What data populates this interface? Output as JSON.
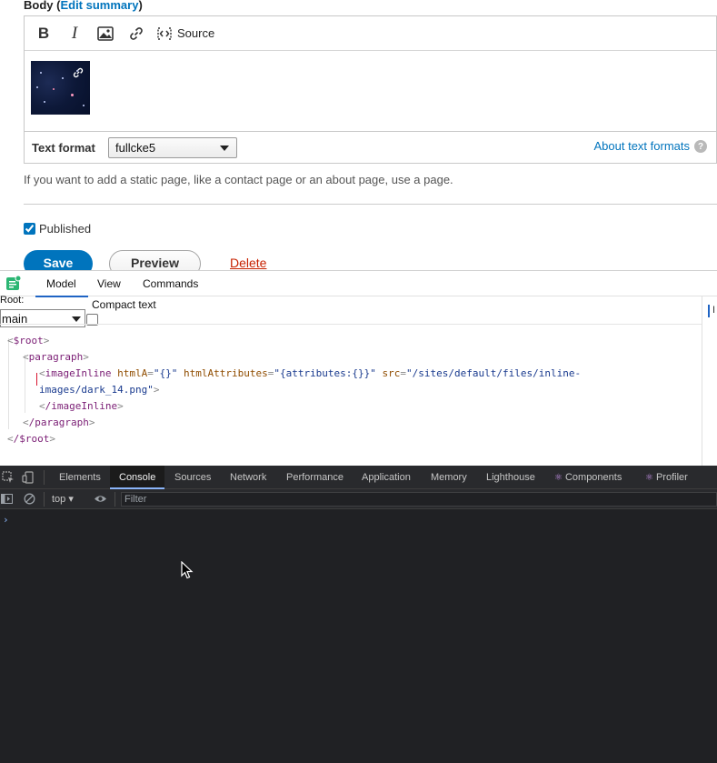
{
  "drupal": {
    "body_label": "Body (",
    "edit_summary": "Edit summary",
    "body_label_close": ")",
    "toolbar": {
      "bold": "B",
      "italic": "I",
      "source_label": "Source"
    },
    "text_format": {
      "label": "Text format",
      "selected": "fullcke5",
      "about_link": "About text formats",
      "help": "?"
    },
    "description": "If you want to add a static page, like a contact page or an about page, use a page.",
    "published_label": "Published",
    "published_checked": true,
    "save_label": "Save",
    "preview_label": "Preview",
    "delete_label": "Delete"
  },
  "inspector": {
    "tabs": [
      "Model",
      "View",
      "Commands"
    ],
    "active_tab": "Model",
    "root_label": "Root:",
    "root_value": "main",
    "compact_text_label": "Compact text",
    "right_tab": "I",
    "tree": {
      "root_open": "$root",
      "paragraph_open": "paragraph",
      "image_tag": "imageInline",
      "attr1_name": "htmlA",
      "attr1_value": "\"{}\"",
      "attr2_name": "htmlAttributes",
      "attr2_value": "\"{attributes:{}}\"",
      "attr3_name": "src",
      "attr3_value_part1": "\"/sites/default/files/inline-",
      "attr3_value_part2": "images/dark_14.png\"",
      "image_close": "/imageInline",
      "paragraph_close": "/paragraph",
      "root_close": "/$root"
    }
  },
  "devtools": {
    "tabs": [
      "Elements",
      "Console",
      "Sources",
      "Network",
      "Performance",
      "Application",
      "Memory",
      "Lighthouse",
      "Components",
      "Profiler"
    ],
    "active_tab": "Console",
    "context": "top",
    "filter_placeholder": "Filter",
    "prompt": "›"
  },
  "colors": {
    "drupal_blue": "#0074bd",
    "delete_red": "#c72100",
    "devtools_bg": "#202124",
    "inspector_accent": "#1f64c4"
  }
}
